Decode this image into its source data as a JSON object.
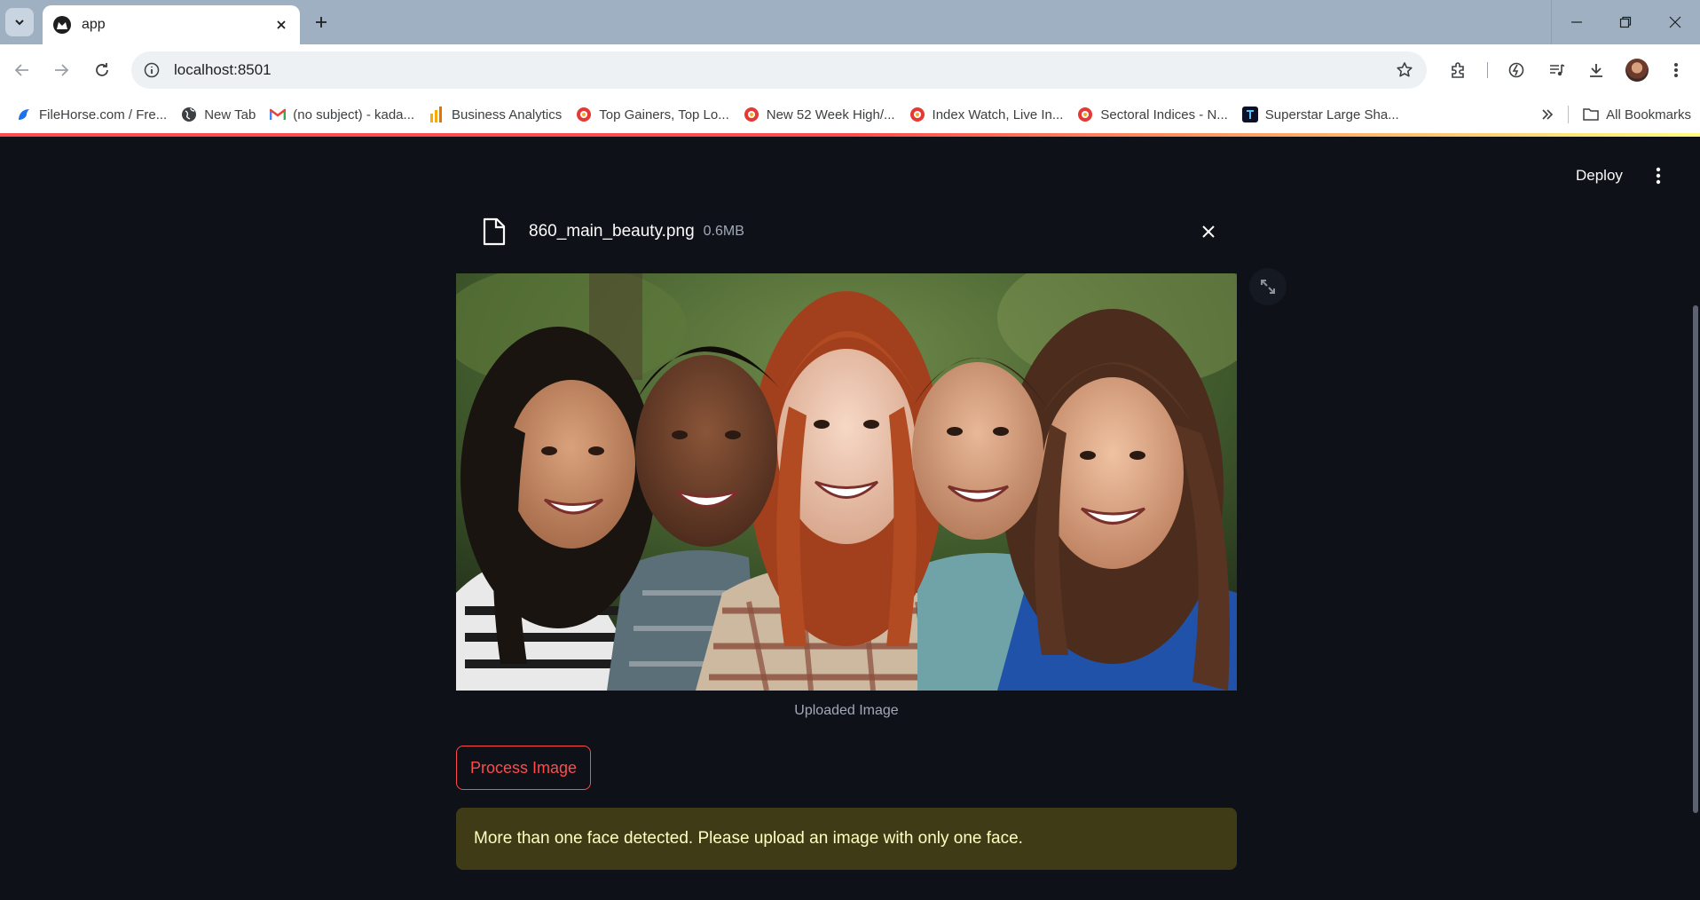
{
  "browser": {
    "tab_title": "app",
    "url": "localhost:8501",
    "bookmarks": [
      {
        "label": "FileHorse.com / Fre...",
        "icon": "filehorse-icon"
      },
      {
        "label": "New Tab",
        "icon": "globe-icon"
      },
      {
        "label": "(no subject) - kada...",
        "icon": "gmail-icon"
      },
      {
        "label": "Business Analytics",
        "icon": "analytics-icon"
      },
      {
        "label": "Top Gainers, Top Lo...",
        "icon": "moneycontrol-icon"
      },
      {
        "label": "New 52 Week High/...",
        "icon": "moneycontrol-icon"
      },
      {
        "label": "Index Watch, Live In...",
        "icon": "moneycontrol-icon"
      },
      {
        "label": "Sectoral Indices - N...",
        "icon": "moneycontrol-icon"
      },
      {
        "label": "Superstar Large Sha...",
        "icon": "trendlyne-icon"
      }
    ],
    "all_bookmarks_label": "All Bookmarks"
  },
  "app": {
    "deploy_label": "Deploy",
    "file": {
      "name": "860_main_beauty.png",
      "size": "0.6MB"
    },
    "image_caption": "Uploaded Image",
    "process_button_label": "Process Image",
    "warning_message": "More than one face detected. Please upload an image with only one face."
  },
  "colors": {
    "accent": "#ff4b4b",
    "app_background": "#0e1117",
    "warning_background": "#3e3b16",
    "warning_text": "#ffffc2"
  }
}
